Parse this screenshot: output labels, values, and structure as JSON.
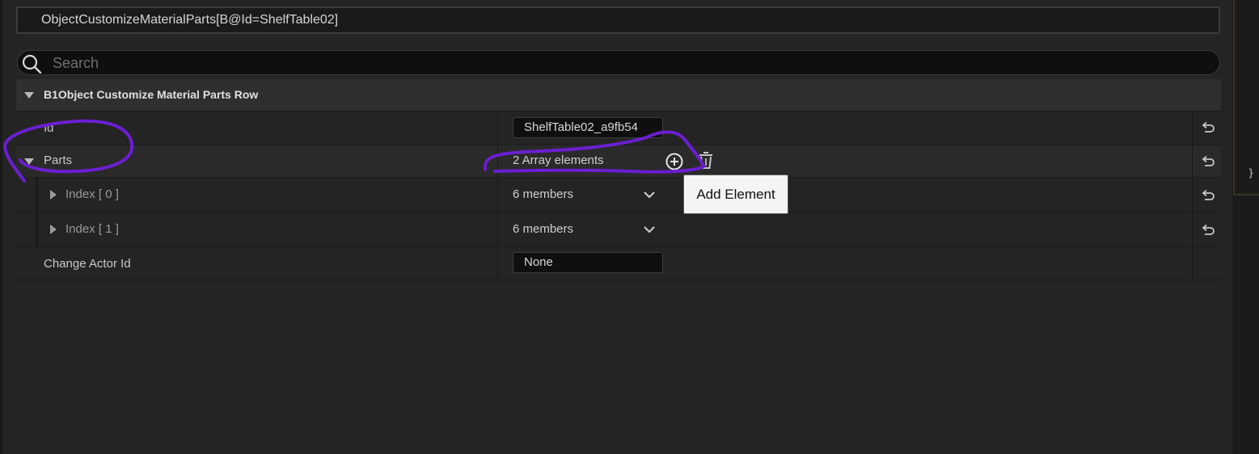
{
  "path_box": {
    "text": "ObjectCustomizeMaterialParts[B@Id=ShelfTable02]"
  },
  "search": {
    "placeholder": "Search",
    "value": ""
  },
  "category": {
    "label": "B1Object Customize Material Parts Row"
  },
  "rows": {
    "id": {
      "label": "Id",
      "value": "ShelfTable02_a9fb54"
    },
    "parts": {
      "label": "Parts",
      "value": "2 Array elements",
      "tooltip": "Add Element"
    },
    "index0": {
      "label": "Index [ 0 ]",
      "value": "6 members"
    },
    "index1": {
      "label": "Index [ 1 ]",
      "value": "6 members"
    },
    "change_actor": {
      "label": "Change Actor Id",
      "value": "None"
    }
  },
  "side": {
    "brace": "}"
  },
  "icons": {
    "search": "search-icon",
    "expand": "triangle-down-icon",
    "collapsed": "triangle-right-icon",
    "add": "plus-circle-icon",
    "delete": "trash-icon",
    "reset": "reset-arrow-icon",
    "dropdown": "chevron-down-icon"
  },
  "colors": {
    "annotation": "#6a1fd0",
    "panel": "#242424",
    "category": "#2f2f2f"
  }
}
